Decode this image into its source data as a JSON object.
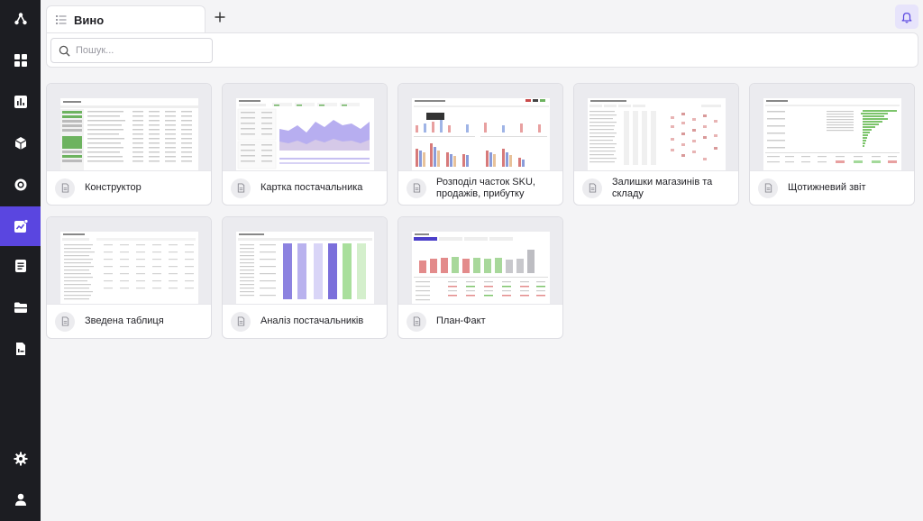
{
  "sidebar": {
    "items": [
      {
        "name": "logo-icon",
        "active": false
      },
      {
        "name": "dashboard-grid-icon",
        "active": false
      },
      {
        "name": "bar-chart-icon",
        "active": false
      },
      {
        "name": "cube-icon",
        "active": false
      },
      {
        "name": "target-icon",
        "active": false
      },
      {
        "name": "analytics-icon",
        "active": true
      },
      {
        "name": "document-list-icon",
        "active": false
      },
      {
        "name": "folder-icon",
        "active": false
      },
      {
        "name": "report-file-icon",
        "active": false
      },
      {
        "name": "settings-gear-icon",
        "active": false
      },
      {
        "name": "user-profile-icon",
        "active": false
      }
    ]
  },
  "tabs": [
    {
      "label": "Вино",
      "icon": "tab-list-icon"
    }
  ],
  "search": {
    "placeholder": "Пошук...",
    "value": ""
  },
  "reports": [
    {
      "title": "Конструктор",
      "icon": "document-icon"
    },
    {
      "title": "Картка постачальника",
      "icon": "document-icon"
    },
    {
      "title": "Розподіл часток SKU, продажів, прибутку",
      "icon": "document-icon"
    },
    {
      "title": "Залишки магазинів та складу",
      "icon": "document-icon"
    },
    {
      "title": "Щотижневий звіт",
      "icon": "document-icon"
    },
    {
      "title": "Зведена таблиця",
      "icon": "document-icon"
    },
    {
      "title": "Аналіз постачальників",
      "icon": "document-icon"
    },
    {
      "title": "План-Факт",
      "icon": "document-icon"
    }
  ],
  "colors": {
    "sidebar_bg": "#1c1d22",
    "accent": "#5a46e0",
    "bell_bg": "#e7e4fb"
  }
}
